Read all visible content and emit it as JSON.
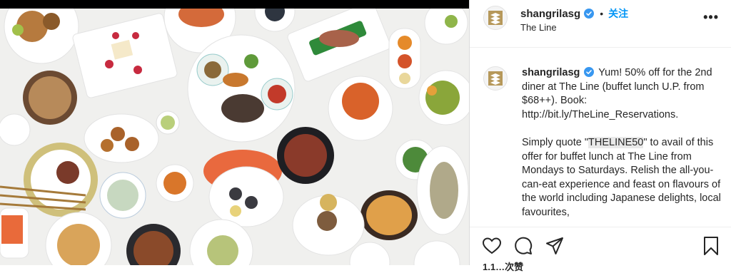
{
  "header": {
    "username": "shangrilasg",
    "separator": "•",
    "follow_label": "关注",
    "location": "The Line",
    "more_label": "•••"
  },
  "caption": {
    "username": "shangrilasg",
    "line1": "Yum! 50% off for the 2nd diner at The Line (buffet lunch U.P. from $68++). Book: http://bit.ly/TheLine_Reservations.",
    "line2_before": "Simply quote \"",
    "line2_code": "THELINE50",
    "line2_after": "\" to avail of this offer for buffet lunch at The Line from Mondays to Saturdays. Relish the all-you-can-eat experience and feast on flavours of the world including Japanese delights, local favourites,"
  },
  "footer": {
    "likes_partial": "1.1…次赞"
  },
  "icons": {
    "like": "heart-icon",
    "comment": "comment-icon",
    "share": "share-icon",
    "save": "bookmark-icon",
    "verified": "verified-badge-icon",
    "more": "more-options-icon"
  },
  "colors": {
    "accent": "#0095f6",
    "brand_gold": "#b6985a"
  }
}
